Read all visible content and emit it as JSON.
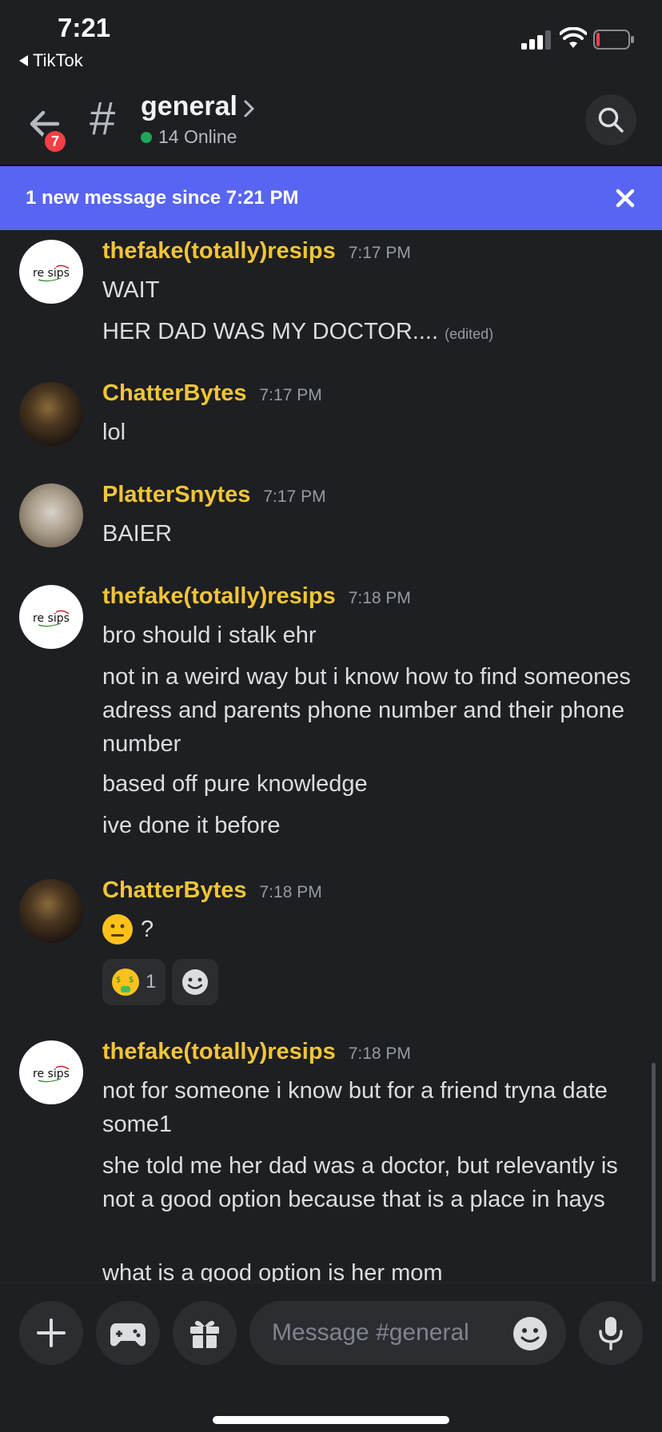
{
  "status_bar": {
    "time": "7:21",
    "back_app": "TikTok"
  },
  "header": {
    "back_badge": "7",
    "channel_name": "general",
    "online": "14 Online",
    "icons": {
      "back": "arrow-left-icon",
      "hash": "hash-icon",
      "search": "search-icon"
    }
  },
  "banner": {
    "text": "1 new message since 7:21 PM"
  },
  "messages": [
    {
      "author": "thefake(totally)resips",
      "time": "7:17 PM",
      "lines": [
        "WAIT",
        "HER DAD WAS MY DOCTOR...."
      ],
      "edited": "(edited)"
    },
    {
      "author": "ChatterBytes",
      "time": "7:17 PM",
      "lines": [
        "lol"
      ]
    },
    {
      "author": "PlatterSnytes",
      "time": "7:17 PM",
      "lines": [
        "BAIER"
      ]
    },
    {
      "author": "thefake(totally)resips",
      "time": "7:18 PM",
      "lines": [
        "bro should i stalk ehr",
        "not in a weird way but i know how to find someones adress and parents phone number and their phone number",
        "based off pure knowledge",
        "ive done it before"
      ]
    },
    {
      "author": "ChatterBytes",
      "time": "7:18 PM",
      "lines": [
        "?"
      ],
      "reactions": [
        {
          "emoji": "money-mouth-face",
          "count": "1"
        }
      ]
    },
    {
      "author": "thefake(totally)resips",
      "time": "7:18 PM",
      "lines": [
        "not for someone i know but for a friend tryna date some1",
        "she told me her dad was a doctor, but relevantly is not a good option because that is a place in hays",
        "what is a good option is her mom"
      ]
    }
  ],
  "avatar_text": "re sips",
  "composer": {
    "placeholder": "Message #general"
  },
  "colors": {
    "username": "#f0c538",
    "banner": "#5865f2",
    "background": "#1e1f22",
    "online": "#23a55a"
  }
}
